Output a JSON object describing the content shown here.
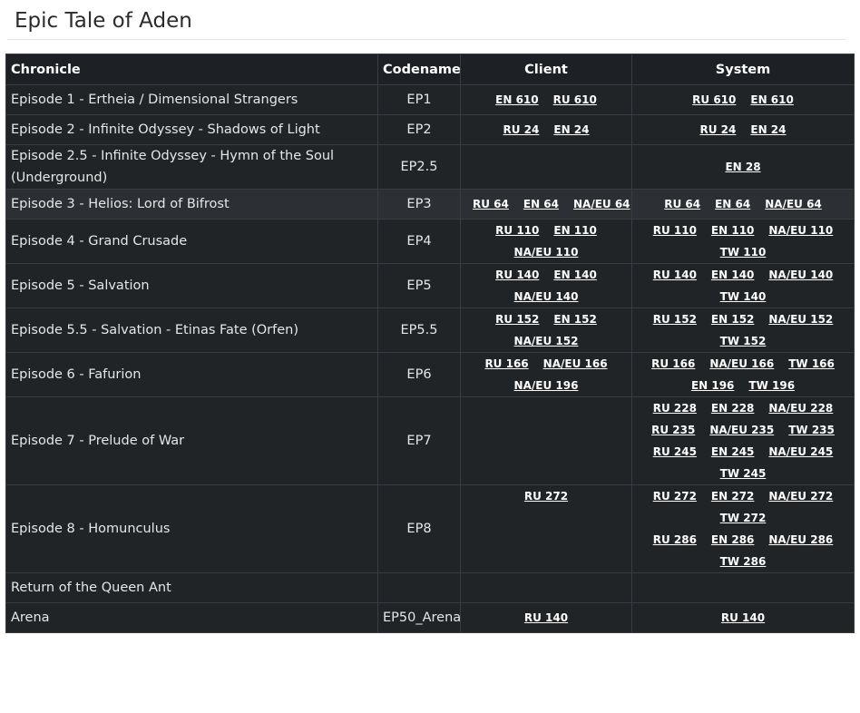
{
  "title": "Epic Tale of Aden",
  "headers": {
    "chronicle": "Chronicle",
    "codename": "Codename",
    "client": "Client",
    "system": "System"
  },
  "rows": [
    {
      "chronicle": "Episode 1 - Ertheia / Dimensional Strangers",
      "codename": "EP1",
      "client": [
        [
          "EN 610",
          "RU 610"
        ]
      ],
      "system": [
        [
          "RU 610",
          "EN 610"
        ]
      ]
    },
    {
      "chronicle": "Episode 2 - Infinite Odyssey - Shadows of Light",
      "codename": "EP2",
      "client": [
        [
          "RU 24",
          "EN 24"
        ]
      ],
      "system": [
        [
          "RU 24",
          "EN 24"
        ]
      ]
    },
    {
      "chronicle": "Episode 2.5 - Infinite Odyssey - Hymn of the Soul (Underground)",
      "codename": "EP2.5",
      "client": [],
      "system": [
        [
          "EN 28"
        ]
      ]
    },
    {
      "chronicle": "Episode 3 - Helios: Lord of Bifrost",
      "codename": "EP3",
      "highlight": true,
      "client": [
        [
          "RU 64",
          "EN 64",
          "NA/EU 64"
        ]
      ],
      "system": [
        [
          "RU 64",
          "EN 64",
          "NA/EU 64"
        ]
      ]
    },
    {
      "chronicle": "Episode 4 - Grand Crusade",
      "codename": "EP4",
      "client": [
        [
          "RU 110",
          "EN 110"
        ],
        [
          "NA/EU 110"
        ]
      ],
      "system": [
        [
          "RU 110",
          "EN 110",
          "NA/EU 110"
        ],
        [
          "TW 110"
        ]
      ]
    },
    {
      "chronicle": "Episode 5 - Salvation",
      "codename": "EP5",
      "client": [
        [
          "RU 140",
          "EN 140"
        ],
        [
          "NA/EU 140"
        ]
      ],
      "system": [
        [
          "RU 140",
          "EN 140",
          "NA/EU 140"
        ],
        [
          "TW 140"
        ]
      ]
    },
    {
      "chronicle": "Episode 5.5 - Salvation - Etinas Fate (Orfen)",
      "codename": "EP5.5",
      "client": [
        [
          "RU 152",
          "EN 152"
        ],
        [
          "NA/EU 152"
        ]
      ],
      "system": [
        [
          "RU 152",
          "EN 152",
          "NA/EU 152"
        ],
        [
          "TW 152"
        ]
      ]
    },
    {
      "chronicle": "Episode 6 - Fafurion",
      "codename": "EP6",
      "client": [
        [
          "RU 166",
          "NA/EU 166"
        ],
        [
          "NA/EU 196"
        ]
      ],
      "system": [
        [
          "RU 166",
          "NA/EU 166",
          "TW 166"
        ],
        [
          "EN 196",
          "TW 196"
        ]
      ]
    },
    {
      "chronicle": "Episode 7 - Prelude of War",
      "codename": "EP7",
      "client": [],
      "system": [
        [
          "RU 228",
          "EN 228",
          "NA/EU 228"
        ],
        [
          "RU 235",
          "NA/EU 235",
          "TW 235"
        ],
        [
          "RU 245",
          "EN 245",
          "NA/EU 245"
        ],
        [
          "TW 245"
        ]
      ]
    },
    {
      "chronicle": "Episode 8 - Homunculus",
      "codename": "EP8",
      "client": [
        [
          "RU 272"
        ]
      ],
      "client_valign": "top",
      "system": [
        [
          "RU 272",
          "EN 272",
          "NA/EU 272"
        ],
        [
          "TW 272"
        ],
        [
          "RU 286",
          "EN 286",
          "NA/EU 286"
        ],
        [
          "TW 286"
        ]
      ]
    },
    {
      "chronicle": "Return of the Queen Ant",
      "codename": "",
      "client": [],
      "system": []
    },
    {
      "chronicle": "Arena",
      "codename": "EP50_Arena",
      "client": [
        [
          "RU 140"
        ]
      ],
      "system": [
        [
          "RU 140"
        ]
      ]
    }
  ]
}
